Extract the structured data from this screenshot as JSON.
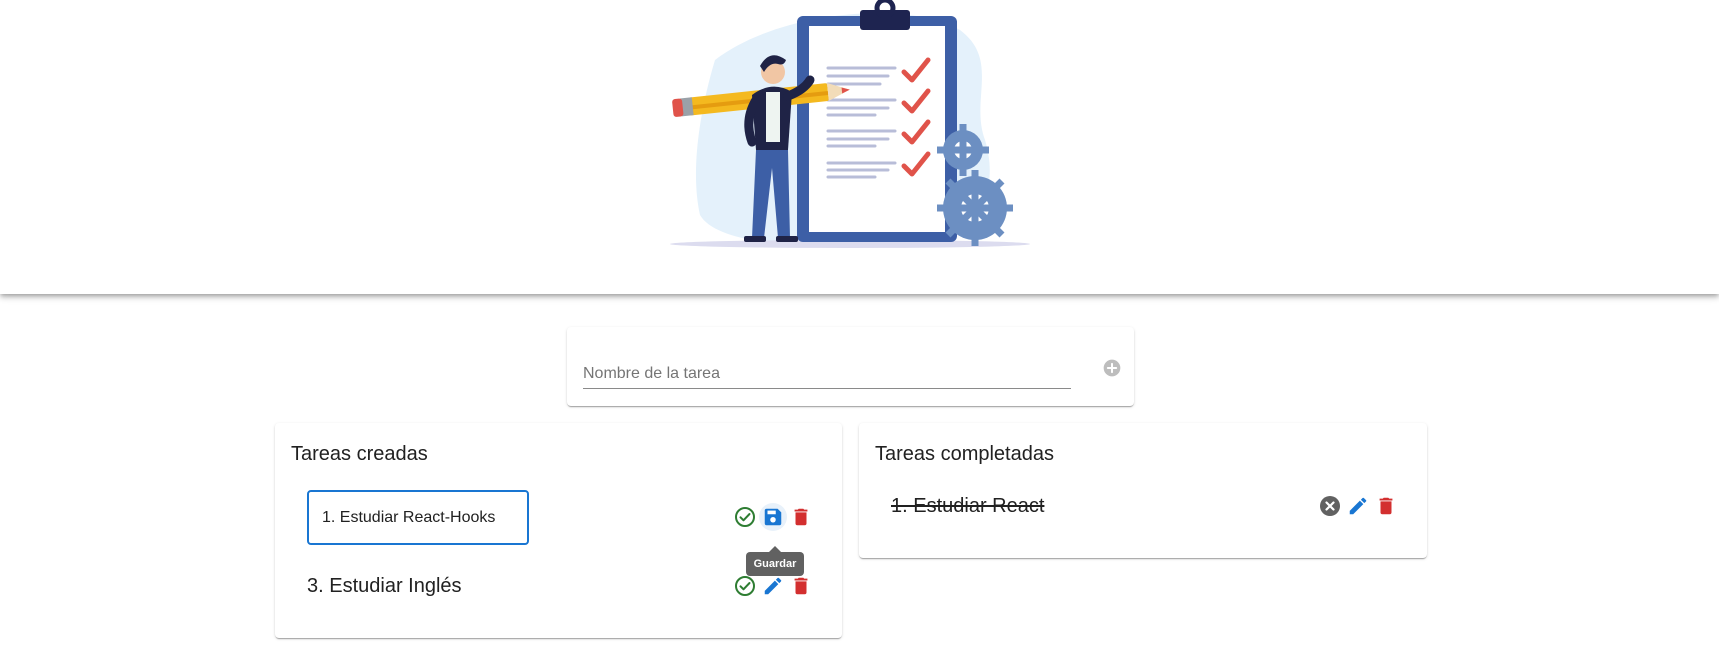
{
  "add_task": {
    "placeholder": "Nombre de la tarea",
    "value": "",
    "add_icon": "add-circle-icon"
  },
  "created_list": {
    "title": "Tareas creadas",
    "editing_task": {
      "value": "1. Estudiar React-Hooks"
    },
    "tasks": [
      {
        "label": "3. Estudiar Inglés"
      }
    ],
    "tooltip": "Guardar"
  },
  "completed_list": {
    "title": "Tareas completadas",
    "tasks": [
      {
        "label": "1. Estudiar React"
      }
    ]
  },
  "colors": {
    "primary": "#1976d2",
    "success": "#2e7d32",
    "danger": "#d32f2f",
    "muted": "#757575"
  }
}
